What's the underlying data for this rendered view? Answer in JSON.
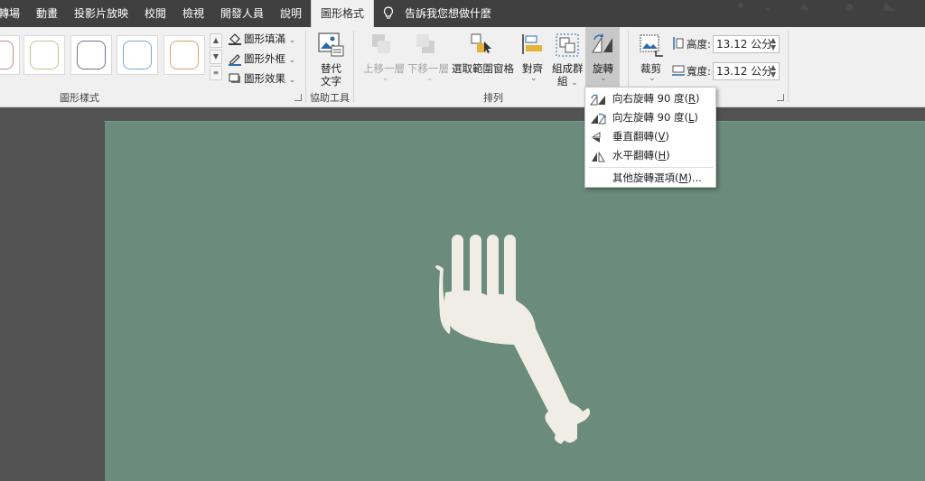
{
  "tabs": [
    "轉場",
    "動畫",
    "投影片放映",
    "校閱",
    "檢視",
    "開發人員",
    "說明",
    "圖形格式"
  ],
  "tell_me": "告訴我您想做什麼",
  "shape_styles": {
    "label": "圖形樣式",
    "fill": "圖形填滿",
    "outline": "圖形外框",
    "effects": "圖形效果"
  },
  "accessibility": {
    "label": "協助工具",
    "alt_text_line1": "替代",
    "alt_text_line2": "文字"
  },
  "arrange": {
    "label": "排列",
    "bring_forward": "上移一層",
    "send_backward": "下移一層",
    "selection_pane": "選取範圍窗格",
    "align": "對齊",
    "group_line1": "組成群",
    "group_line2": "組",
    "rotate": "旋轉"
  },
  "size": {
    "crop": "裁剪",
    "height_label": "高度:",
    "height_value": "13.12 公分",
    "width_label": "寬度:",
    "width_value": "13.12 公分"
  },
  "rotate_menu": {
    "items": [
      {
        "text": "向右旋轉 90 度(",
        "key": "R",
        "tail": ")"
      },
      {
        "text": "向左旋轉 90 度(",
        "key": "L",
        "tail": ")"
      },
      {
        "text": "垂直翻轉(",
        "key": "V",
        "tail": ")"
      },
      {
        "text": "水平翻轉(",
        "key": "H",
        "tail": ")"
      },
      {
        "text": "其他旋轉選項(",
        "key": "M",
        "tail": ")..."
      }
    ]
  },
  "colors": {
    "ribbon_bg": "#f0f0f0",
    "tab_bar_bg": "#404040",
    "slide_bg": "#6b8b7c",
    "shape_fill": "#f0ede4",
    "accent_blue": "#2b6cb0"
  }
}
